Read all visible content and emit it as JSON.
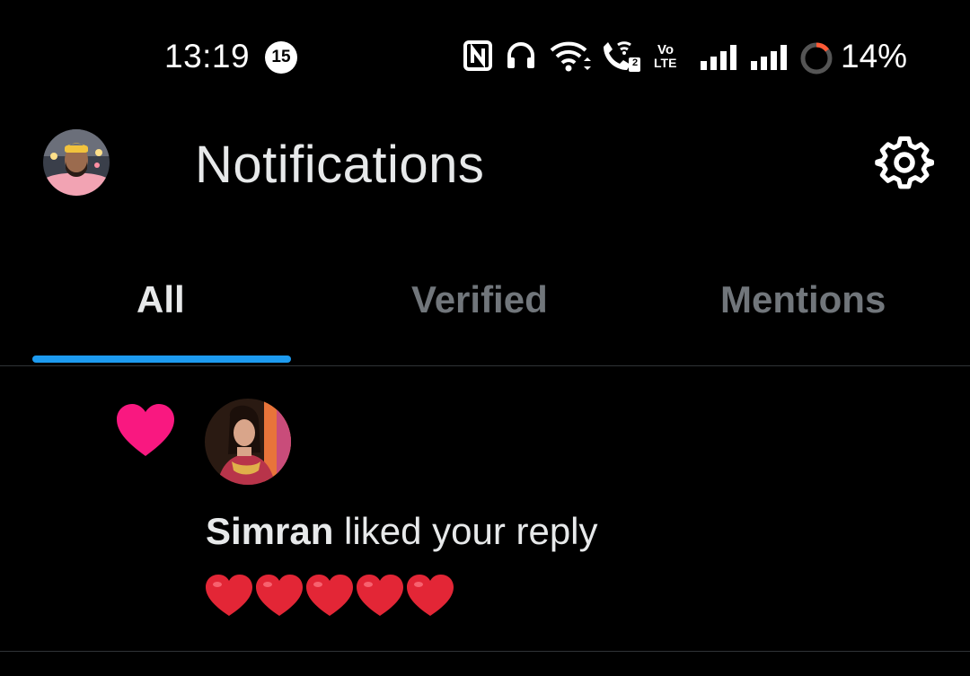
{
  "status_bar": {
    "time": "13:19",
    "notification_count": "15",
    "icons": [
      "nfc-icon",
      "headphones-icon",
      "wifi-icon",
      "wifi-calling-icon",
      "volte-icon",
      "signal-icon",
      "signal-icon",
      "battery-icon"
    ],
    "volte_text_top": "Vo",
    "volte_text_bottom": "LTE",
    "wifi_call_sim": "2",
    "battery": "14%"
  },
  "header": {
    "title": "Notifications"
  },
  "tabs": [
    {
      "label": "All",
      "active": true
    },
    {
      "label": "Verified",
      "active": false
    },
    {
      "label": "Mentions",
      "active": false
    }
  ],
  "notification": {
    "type": "like",
    "user_name": "Simran",
    "action_text": " liked your reply",
    "emojis": "❤️❤️❤️❤️❤️"
  },
  "colors": {
    "accent": "#1d9bf0",
    "like": "#f91880",
    "text_primary": "#e7e9ea",
    "text_secondary": "#71767b"
  }
}
